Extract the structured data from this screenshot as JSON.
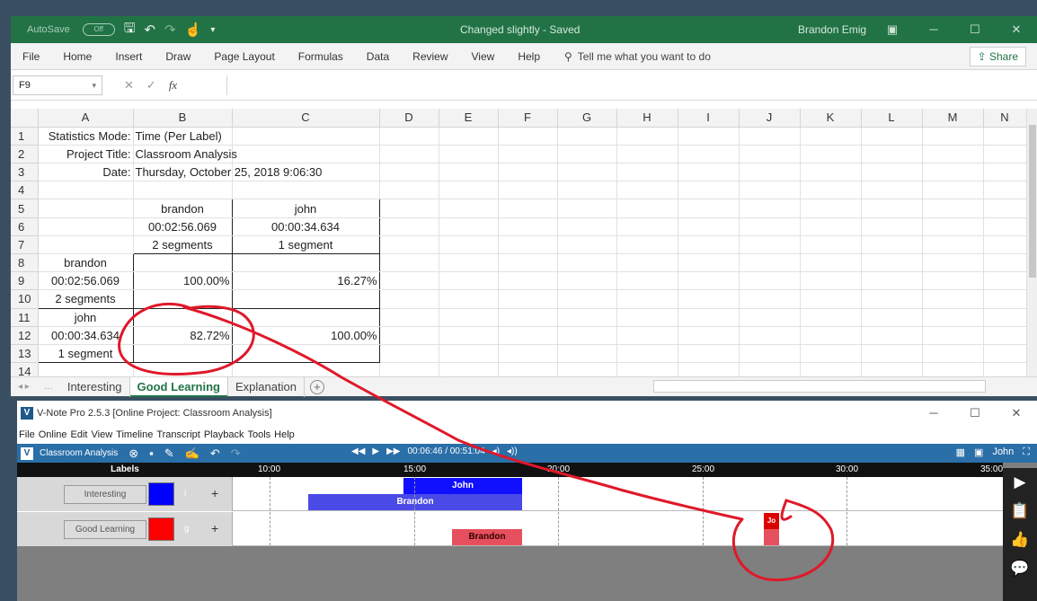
{
  "excel": {
    "title_bar": {
      "autosave_label": "AutoSave",
      "autosave_state": "Off",
      "doc_title": "Changed slightly - Saved",
      "user": "Brandon Emig"
    },
    "menu": [
      "File",
      "Home",
      "Insert",
      "Draw",
      "Page Layout",
      "Formulas",
      "Data",
      "Review",
      "View",
      "Help"
    ],
    "tell_me": "Tell me what you want to do",
    "share_label": "Share",
    "name_box": "F9",
    "fx_label": "fx",
    "columns": [
      "A",
      "B",
      "C",
      "D",
      "E",
      "F",
      "G",
      "H",
      "I",
      "J",
      "K",
      "L",
      "M",
      "N"
    ],
    "rows": [
      {
        "n": "1",
        "A": "Statistics Mode:",
        "B": "Time (Per Label)",
        "C": ""
      },
      {
        "n": "2",
        "A": "Project Title:",
        "B": "Classroom Analysis",
        "C": ""
      },
      {
        "n": "3",
        "A": "Date:",
        "B": "Thursday, October 25, 2018 9:06:30",
        "C": ""
      },
      {
        "n": "4",
        "A": "",
        "B": "",
        "C": ""
      },
      {
        "n": "5",
        "A": "",
        "B": "brandon",
        "C": "john"
      },
      {
        "n": "6",
        "A": "",
        "B": "00:02:56.069",
        "C": "00:00:34.634"
      },
      {
        "n": "7",
        "A": "",
        "B": "2 segments",
        "C": "1 segment"
      },
      {
        "n": "8",
        "A": "brandon",
        "B": "",
        "C": ""
      },
      {
        "n": "9",
        "A": "00:02:56.069",
        "B": "100.00%",
        "C": "16.27%"
      },
      {
        "n": "10",
        "A": "2 segments",
        "B": "",
        "C": ""
      },
      {
        "n": "11",
        "A": "john",
        "B": "",
        "C": ""
      },
      {
        "n": "12",
        "A": "00:00:34.634",
        "B": "82.72%",
        "C": "100.00%"
      },
      {
        "n": "13",
        "A": "1 segment",
        "B": "",
        "C": ""
      },
      {
        "n": "14",
        "A": "",
        "B": "",
        "C": ""
      }
    ],
    "sheet_tabs": [
      "Interesting",
      "Good Learning",
      "Explanation"
    ],
    "active_sheet": "Good Learning"
  },
  "vnote": {
    "window_title": "V-Note Pro 2.5.3 [Online Project: Classroom Analysis]",
    "menu": [
      "File",
      "Online",
      "Edit",
      "View",
      "Timeline",
      "Transcript",
      "Playback",
      "Tools",
      "Help"
    ],
    "project_name": "Classroom Analysis",
    "playback_time": "00:06:46 / 00:51:04",
    "user": "John",
    "labels_header": "Labels",
    "ticks": [
      "10:00",
      "15:00",
      "20:00",
      "25:00",
      "30:00",
      "35:00"
    ],
    "lanes": [
      {
        "name": "Interesting",
        "key": "i",
        "color": "#0000ff"
      },
      {
        "name": "Good Learning",
        "key": "g",
        "color": "#ff0000"
      }
    ],
    "segments": {
      "interesting_john": "John",
      "interesting_brandon": "Brandon",
      "good_brandon": "Brandon",
      "good_john": "Jo"
    },
    "colors": {
      "toolbar": "#2a6fa8",
      "excel_green": "#217346",
      "annotation": "#e0182a"
    }
  }
}
